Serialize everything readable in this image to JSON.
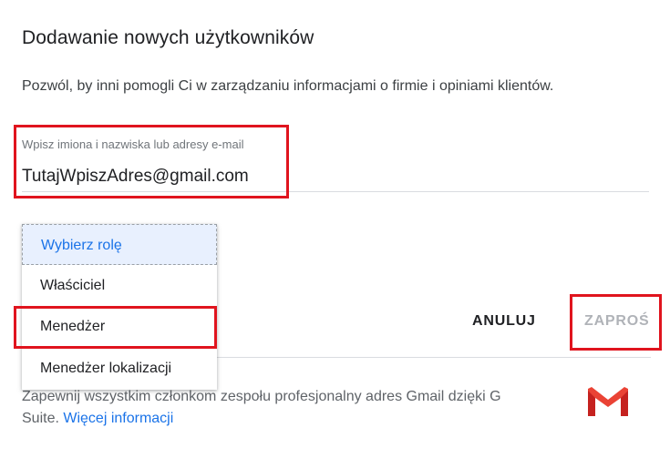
{
  "dialog": {
    "title": "Dodawanie nowych użytkowników",
    "subtitle": "Pozwól, by inni pomogli Ci w zarządzaniu informacjami o firmie i opiniami klientów."
  },
  "email_field": {
    "label": "Wpisz imiona i nazwiska lub adresy e-mail",
    "value": "TutajWpiszAdres@gmail.com"
  },
  "role_dropdown": {
    "items": [
      {
        "label": "Wybierz rolę",
        "selected": true
      },
      {
        "label": "Właściciel",
        "selected": false
      },
      {
        "label": "Menedżer",
        "selected": false
      },
      {
        "label": "Menedżer lokalizacji",
        "selected": false
      }
    ]
  },
  "actions": {
    "cancel_label": "ANULUJ",
    "invite_label": "ZAPROŚ"
  },
  "promo": {
    "text": "Zapewnij wszystkim członkom zespołu profesjonalny adres Gmail dzięki G Suite.",
    "link_text": "Więcej informacji",
    "icon": "gmail-icon"
  },
  "colors": {
    "highlight": "#e0141e",
    "accent": "#1a73e8"
  }
}
